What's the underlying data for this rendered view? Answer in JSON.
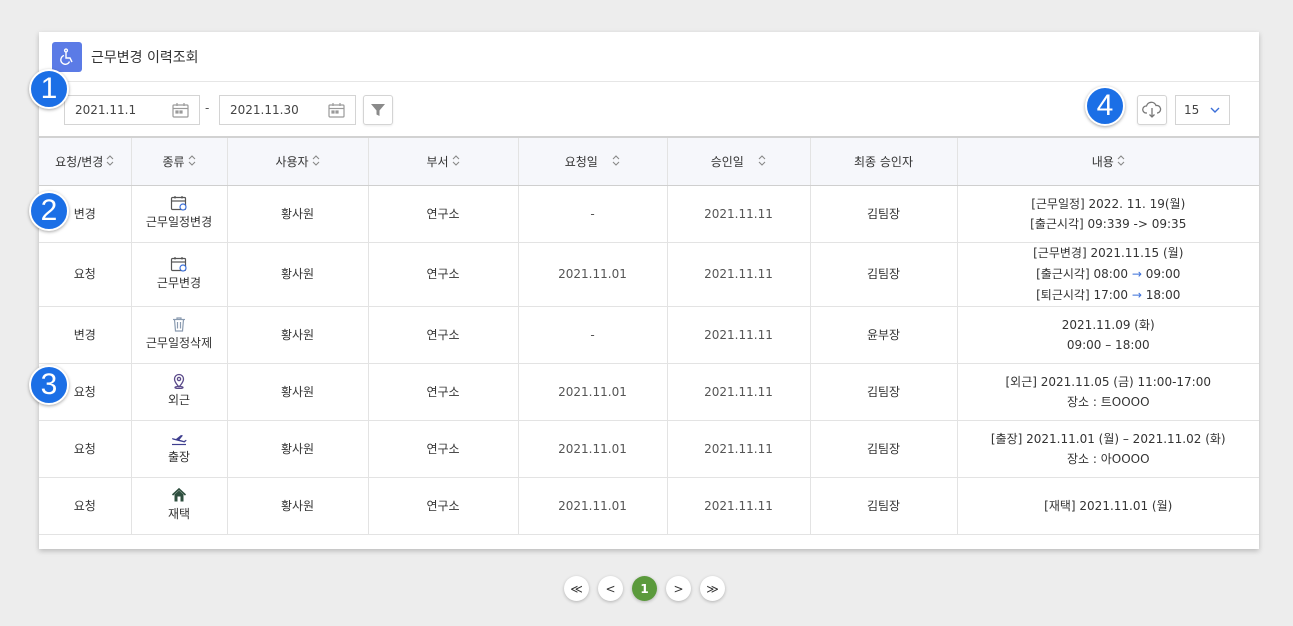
{
  "header": {
    "title": "근무변경 이력조회"
  },
  "filters": {
    "start_date": "2021.11.1",
    "separator": "-",
    "end_date": "2021.11.30"
  },
  "page_size": "15",
  "table": {
    "columns": [
      "요청/변경",
      "종류",
      "사용자",
      "부서",
      "요청일",
      "승인일",
      "최종 승인자",
      "내용"
    ],
    "rows": [
      {
        "kind": "변경",
        "type": "근무일정변경",
        "type_icon": "calendar-edit-icon",
        "user": "황사원",
        "dept": "연구소",
        "request_date": "-",
        "approve_date": "2021.11.11",
        "approver": "김팀장",
        "content": [
          "[근무일정] 2022. 11. 19(월)",
          "[출근시각] 09:339 -> 09:35"
        ]
      },
      {
        "kind": "요청",
        "type": "근무변경",
        "type_icon": "calendar-edit-icon",
        "user": "황사원",
        "dept": "연구소",
        "request_date": "2021.11.01",
        "approve_date": "2021.11.11",
        "approver": "김팀장",
        "content": [
          "[근무변경] 2021.11.15 (월)",
          "[출근시각] 08:00",
          "09:00",
          "[퇴근시각] 17:00",
          "18:00"
        ]
      },
      {
        "kind": "변경",
        "type": "근무일정삭제",
        "type_icon": "trash-icon",
        "user": "황사원",
        "dept": "연구소",
        "request_date": "-",
        "approve_date": "2021.11.11",
        "approver": "윤부장",
        "content": [
          "2021.11.09 (화)",
          "09:00 – 18:00"
        ]
      },
      {
        "kind": "요청",
        "type": "외근",
        "type_icon": "location-pin-icon",
        "user": "황사원",
        "dept": "연구소",
        "request_date": "2021.11.01",
        "approve_date": "2021.11.11",
        "approver": "김팀장",
        "content": [
          "[외근] 2021.11.05 (금) 11:00-17:00",
          "장소 : 트OOOO"
        ]
      },
      {
        "kind": "요청",
        "type": "출장",
        "type_icon": "airplane-icon",
        "user": "황사원",
        "dept": "연구소",
        "request_date": "2021.11.01",
        "approve_date": "2021.11.11",
        "approver": "김팀장",
        "content": [
          "[출장] 2021.11.01 (월) – 2021.11.02 (화)",
          "장소 : 아OOOO"
        ]
      },
      {
        "kind": "요청",
        "type": "재택",
        "type_icon": "home-icon",
        "user": "황사원",
        "dept": "연구소",
        "request_date": "2021.11.01",
        "approve_date": "2021.11.11",
        "approver": "김팀장",
        "content": [
          "[재택] 2021.11.01 (월)"
        ]
      }
    ]
  },
  "badges": [
    "1",
    "2",
    "3",
    "4"
  ],
  "pagination": {
    "first": "≪",
    "prev": "<",
    "current": "1",
    "next": ">",
    "last": "≫"
  },
  "colors": {
    "accent": "#5b7be6",
    "badge": "#1b6fe6",
    "page_active": "#5b9a3c",
    "arrow": "#3b6fd9"
  }
}
